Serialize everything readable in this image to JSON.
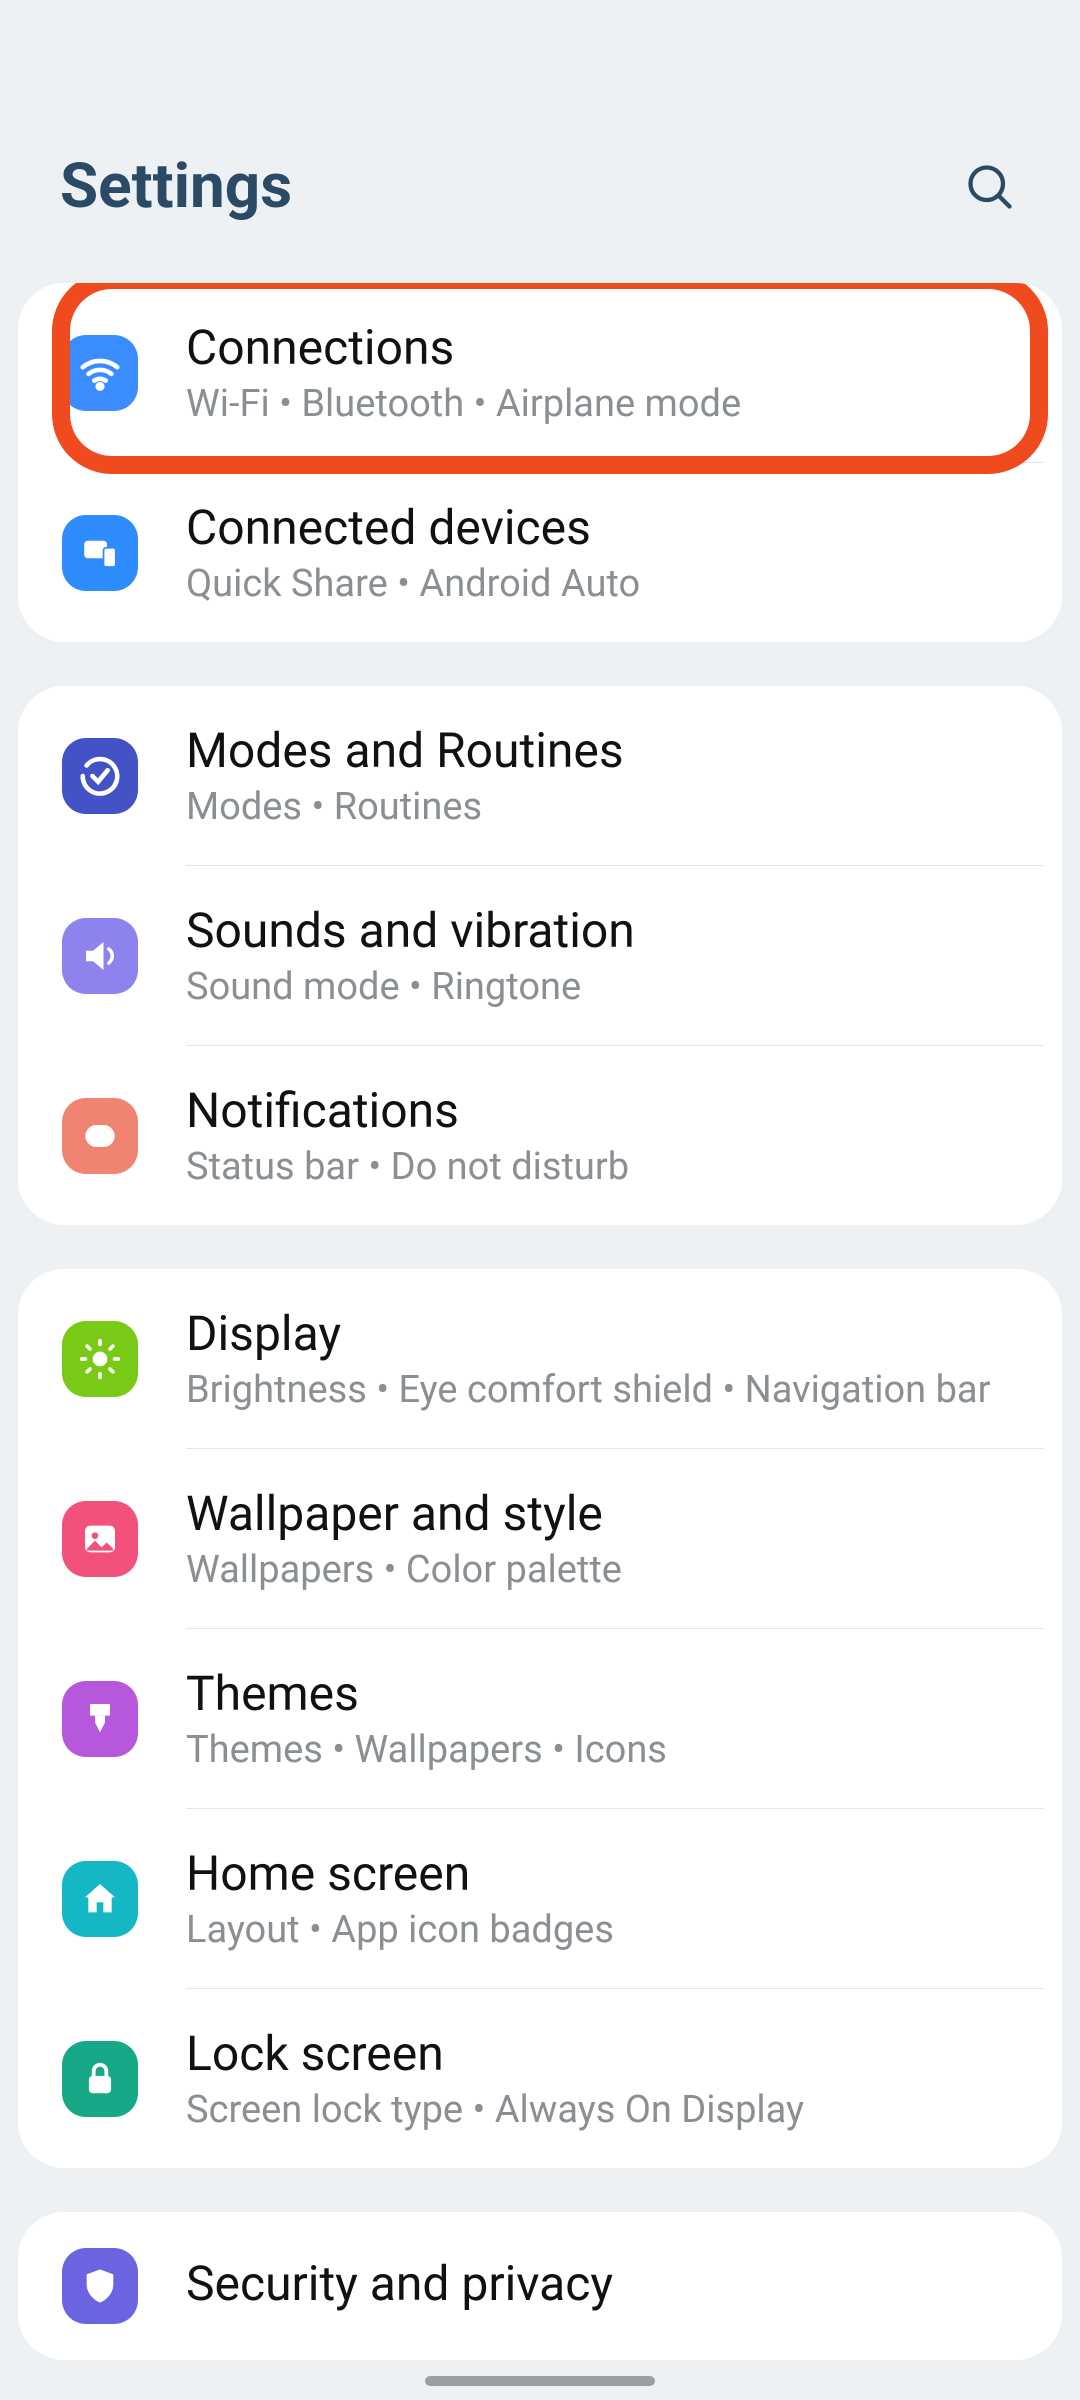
{
  "header": {
    "title": "Settings"
  },
  "groups": [
    {
      "items": [
        {
          "id": "connections",
          "title": "Connections",
          "sub": "Wi-Fi  •  Bluetooth  •  Airplane mode",
          "iconClass": "ic-blue",
          "icon": "wifi",
          "highlight": true
        },
        {
          "id": "connected-devices",
          "title": "Connected devices",
          "sub": "Quick Share  •  Android Auto",
          "iconClass": "ic-blue2",
          "icon": "devices"
        }
      ]
    },
    {
      "items": [
        {
          "id": "modes-routines",
          "title": "Modes and Routines",
          "sub": "Modes  •  Routines",
          "iconClass": "ic-indigo",
          "icon": "check-circle"
        },
        {
          "id": "sounds-vibration",
          "title": "Sounds and vibration",
          "sub": "Sound mode  •  Ringtone",
          "iconClass": "ic-lav",
          "icon": "speaker"
        },
        {
          "id": "notifications",
          "title": "Notifications",
          "sub": "Status bar  •  Do not disturb",
          "iconClass": "ic-coral",
          "icon": "notif"
        }
      ]
    },
    {
      "items": [
        {
          "id": "display",
          "title": "Display",
          "sub": "Brightness  •  Eye comfort shield  •  Navigation bar",
          "iconClass": "ic-green",
          "icon": "sun"
        },
        {
          "id": "wallpaper",
          "title": "Wallpaper and style",
          "sub": "Wallpapers  •  Color palette",
          "iconClass": "ic-pink",
          "icon": "image"
        },
        {
          "id": "themes",
          "title": "Themes",
          "sub": "Themes  •  Wallpapers  •  Icons",
          "iconClass": "ic-purple",
          "icon": "brush"
        },
        {
          "id": "home-screen",
          "title": "Home screen",
          "sub": "Layout  •  App icon badges",
          "iconClass": "ic-cyan",
          "icon": "home"
        },
        {
          "id": "lock-screen",
          "title": "Lock screen",
          "sub": "Screen lock type  •  Always On Display",
          "iconClass": "ic-teal",
          "icon": "lock"
        }
      ]
    },
    {
      "items": [
        {
          "id": "security-privacy",
          "title": "Security and privacy",
          "sub": "",
          "iconClass": "ic-violet",
          "icon": "shield"
        }
      ]
    }
  ]
}
